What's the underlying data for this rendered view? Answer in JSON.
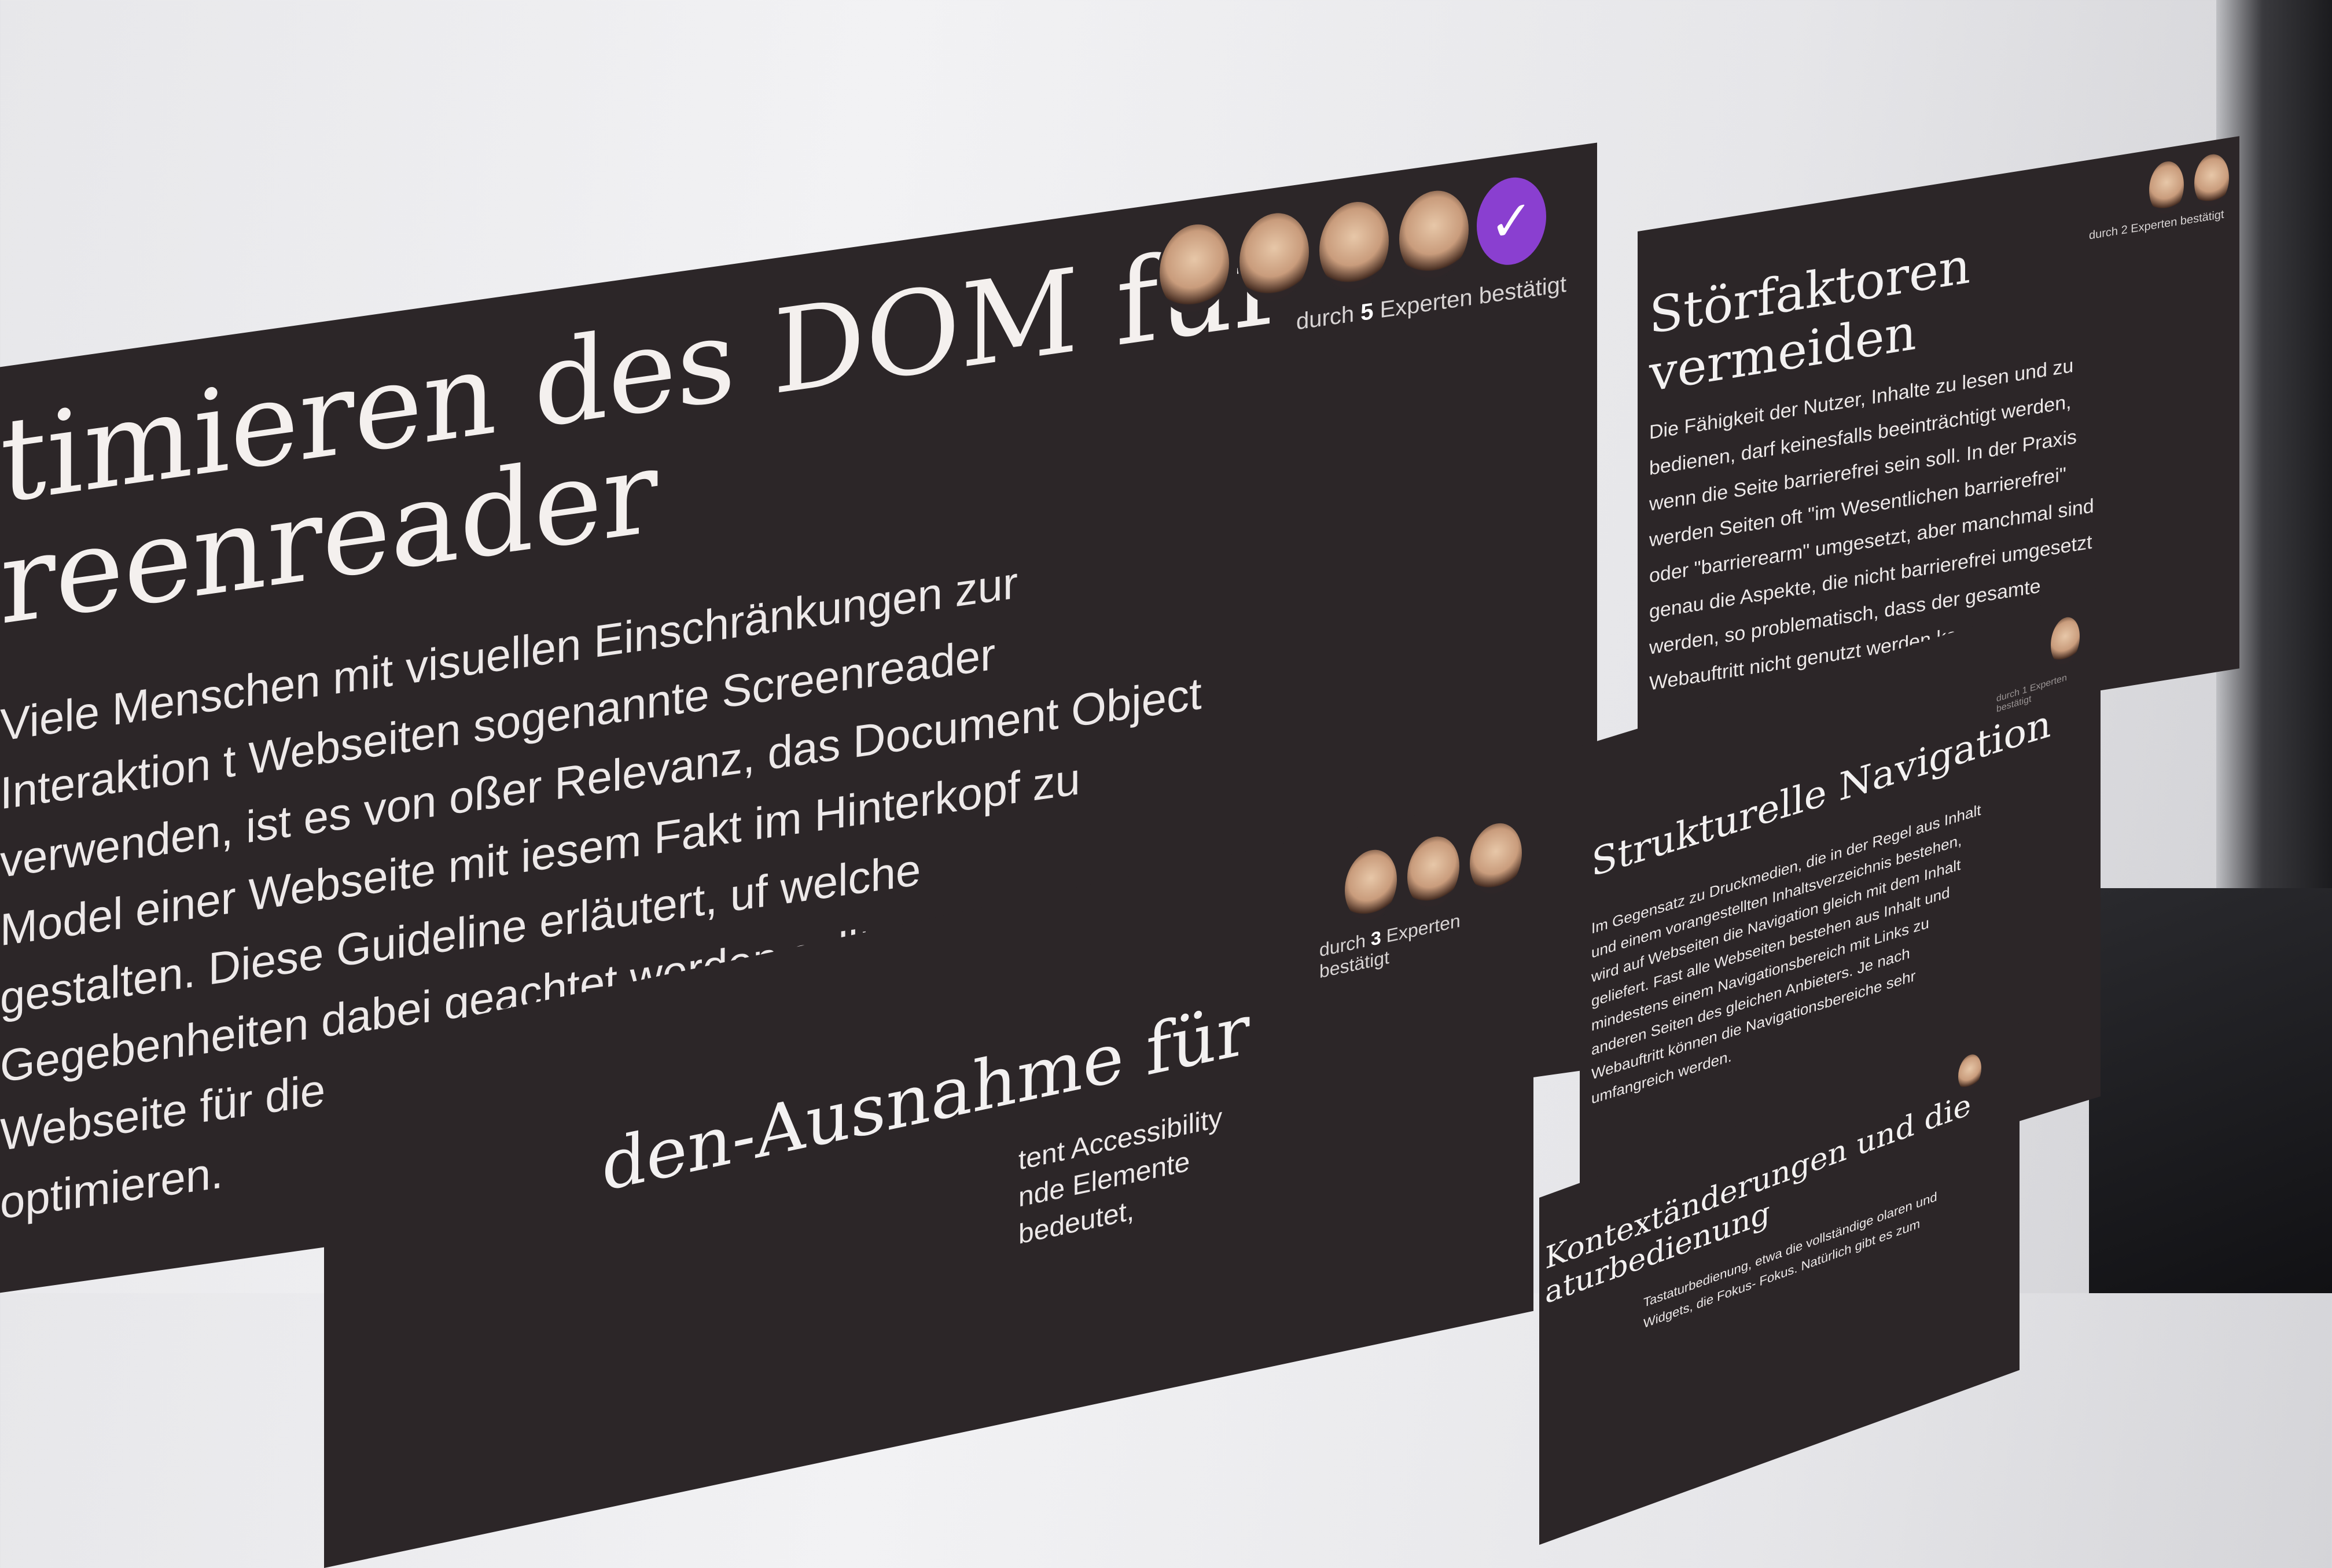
{
  "main_card": {
    "title_line1": "timieren des DOM für",
    "title_line2": "reenreader",
    "body": "Viele Menschen mit visuellen Einschränkungen zur Interaktion t Webseiten sogenannte Screenreader verwenden, ist es von oßer Relevanz, das Document Object Model einer Webseite mit iesem Fakt im Hinterkopf zu gestalten. Diese Guideline erläutert, uf welche Gegebenheiten dabei geachtet werden sollte, um eine Webseite für die Nutzung anhand eines Screenreaders zu optimieren.",
    "confirm_prefix": "durch",
    "confirm_count": "5",
    "confirm_suffix": "Experten bestätigt",
    "check_icon": "✓"
  },
  "card_stoerfaktoren": {
    "title": "Störfaktoren vermeiden",
    "body": "Die Fähigkeit der Nutzer, Inhalte zu lesen und zu bedienen, darf keinesfalls beeinträchtigt werden, wenn die Seite barrierefrei sein soll. In der Praxis werden Seiten oft \"im Wesentlichen barrierefrei\" oder \"barrierearm\" umgesetzt, aber manchmal sind genau die Aspekte, die nicht barrierefrei umgesetzt werden, so problematisch, dass der gesamte Webauftritt nicht genutzt werden kann.",
    "confirm": "durch 2 Experten bestätigt"
  },
  "card_navigation": {
    "title": "Strukturelle Navigation",
    "body": "Im Gegensatz zu Druckmedien, die in der Regel aus Inhalt und einem vorangestellten Inhaltsverzeichnis bestehen, wird auf Webseiten die Navigation gleich mit dem Inhalt geliefert. Fast alle Webseiten bestehen aus Inhalt und mindestens einem Navigationsbereich mit Links zu anderen Seiten des gleichen Anbieters. Je nach Webauftritt können die Navigationsbereiche sehr umfangreich werden.",
    "confirm": "durch 1 Experten bestätigt"
  },
  "card_ausnahme": {
    "title": "den-Ausnahme für",
    "body_line1": "tent Accessibility",
    "body_line2": "nde Elemente",
    "body_line3": "bedeutet,",
    "confirm_prefix": "durch",
    "confirm_count": "3",
    "confirm_suffix": "Experten bestätigt"
  },
  "card_kontext": {
    "title_line1": "Kontextänderungen und die",
    "title_line2": "aturbedienung",
    "body": "Tastaturbedienung, etwa die vollständige olaren und Widgets, die Fokus- Fokus. Natürlich gibt es zum"
  }
}
